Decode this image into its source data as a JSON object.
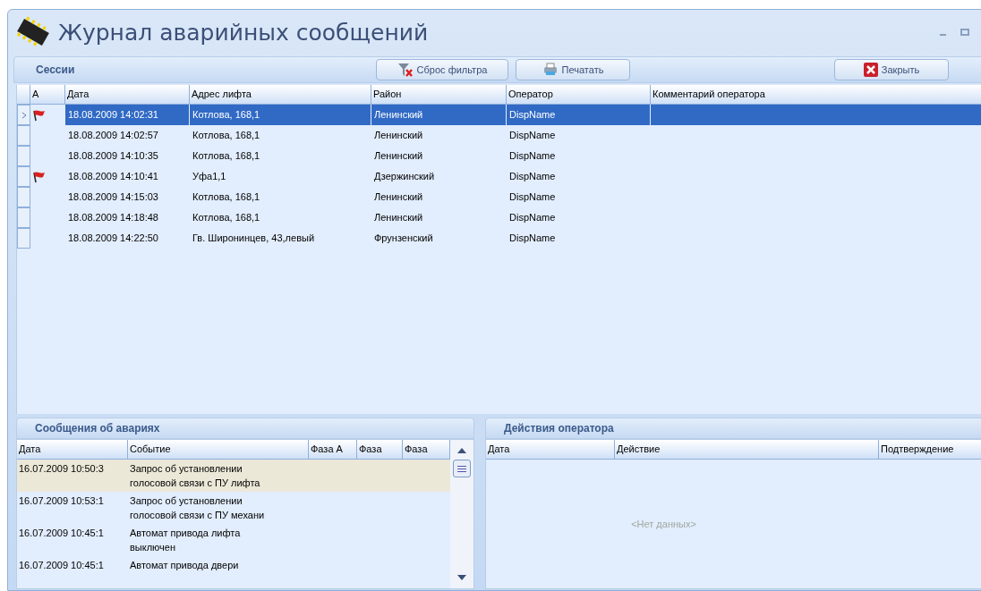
{
  "window": {
    "title": "Журнал аварийных сообщений"
  },
  "sessions": {
    "title": "Сессии",
    "buttons": [
      {
        "kind": "filter",
        "label": "Сброс фильтра"
      },
      {
        "kind": "print",
        "label": "Печатать"
      },
      {
        "kind": "close",
        "label": "Закрыть"
      }
    ],
    "columns": [
      "А",
      "Дата",
      "Адрес лифта",
      "Район",
      "Оператор",
      "Комментарий оператора"
    ],
    "rows": [
      {
        "selected": true,
        "alarm": true,
        "date": "18.08.2009 14:02:31",
        "address": "Котлова, 168,1",
        "district": "Ленинский",
        "operator": "DispName"
      },
      {
        "selected": false,
        "alarm": false,
        "date": "18.08.2009 14:02:57",
        "address": "Котлова, 168,1",
        "district": "Ленинский",
        "operator": "DispName"
      },
      {
        "selected": false,
        "alarm": false,
        "date": "18.08.2009 14:10:35",
        "address": "Котлова, 168,1",
        "district": "Ленинский",
        "operator": "DispName"
      },
      {
        "selected": false,
        "alarm": true,
        "date": "18.08.2009 14:10:41",
        "address": "Уфа1,1",
        "district": "Дзержинский",
        "operator": "DispName"
      },
      {
        "selected": false,
        "alarm": false,
        "date": "18.08.2009 14:15:03",
        "address": "Котлова, 168,1",
        "district": "Ленинский",
        "operator": "DispName"
      },
      {
        "selected": false,
        "alarm": false,
        "date": "18.08.2009 14:18:48",
        "address": "Котлова, 168,1",
        "district": "Ленинский",
        "operator": "DispName"
      },
      {
        "selected": false,
        "alarm": false,
        "date": "18.08.2009 14:22:50",
        "address": "Гв. Широнинцев, 43,левый",
        "district": "Фрунзенский",
        "operator": "DispName"
      }
    ]
  },
  "alarms": {
    "title": "Сообщения об авариях",
    "columns": [
      "Дата",
      "Событие",
      "Фаза A",
      "Фаза",
      "Фаза"
    ],
    "rows": [
      {
        "selected": true,
        "date": "16.07.2009 10:50:3",
        "event": "Запрос об установлении голосовой связи с ПУ лифта"
      },
      {
        "selected": false,
        "date": "16.07.2009 10:53:1",
        "event": "Запрос об установлении голосовой связи с ПУ механи"
      },
      {
        "selected": false,
        "date": "16.07.2009 10:45:1",
        "event": "Автомат привода лифта выключен"
      },
      {
        "selected": false,
        "date": "16.07.2009 10:45:1",
        "event": "Автомат привода двери"
      }
    ]
  },
  "actions": {
    "title": "Действия оператора",
    "columns": [
      "Дата",
      "Действие",
      "Подтверждение"
    ],
    "empty": "<Нет данных>"
  }
}
